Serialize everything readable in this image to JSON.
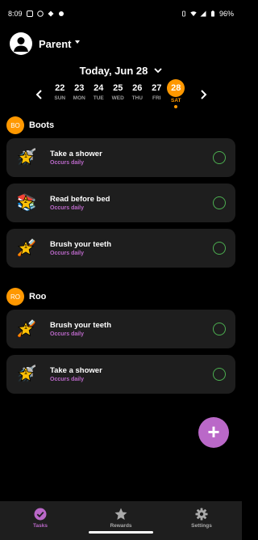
{
  "status_bar": {
    "time": "8:09",
    "battery": "96%"
  },
  "header": {
    "user_label": "Parent"
  },
  "date_title": "Today, Jun 28",
  "week": [
    {
      "num": "22",
      "name": "SUN",
      "selected": false
    },
    {
      "num": "23",
      "name": "MON",
      "selected": false
    },
    {
      "num": "24",
      "name": "TUE",
      "selected": false
    },
    {
      "num": "25",
      "name": "WED",
      "selected": false
    },
    {
      "num": "26",
      "name": "THU",
      "selected": false
    },
    {
      "num": "27",
      "name": "FRI",
      "selected": false
    },
    {
      "num": "28",
      "name": "SAT",
      "selected": true
    }
  ],
  "kids": [
    {
      "initials": "BO",
      "name": "Boots",
      "tasks": [
        {
          "title": "Take a shower",
          "subtitle": "Occurs daily",
          "emoji": "🚿",
          "stars": "1"
        },
        {
          "title": "Read before bed",
          "subtitle": "Occurs daily",
          "emoji": "📚",
          "stars": "2"
        },
        {
          "title": "Brush your teeth",
          "subtitle": "Occurs daily",
          "emoji": "🪥",
          "stars": "1"
        }
      ]
    },
    {
      "initials": "RO",
      "name": "Roo",
      "tasks": [
        {
          "title": "Brush your teeth",
          "subtitle": "Occurs daily",
          "emoji": "🪥",
          "stars": "1"
        },
        {
          "title": "Take a shower",
          "subtitle": "Occurs daily",
          "emoji": "🚿",
          "stars": "1"
        }
      ]
    }
  ],
  "fab": {
    "symbol": "+"
  },
  "nav": {
    "tasks": "Tasks",
    "rewards": "Rewards",
    "settings": "Settings"
  },
  "colors": {
    "accent": "#ba68c8",
    "orange": "#ff9800",
    "check": "#4caf50",
    "card": "#1e1e1e"
  }
}
